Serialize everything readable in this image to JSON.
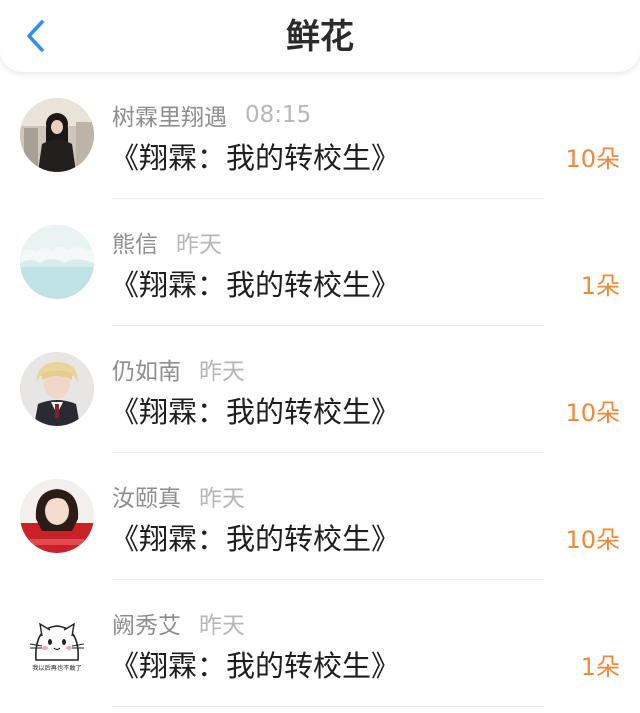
{
  "header": {
    "title": "鲜花",
    "back_icon": "chevron-left-icon",
    "accent": "#2a8ff0"
  },
  "colors": {
    "count": "#f08a3a",
    "name": "#8e8e8e",
    "time": "#b7b7b7",
    "text": "#1e1e1e"
  },
  "rows": [
    {
      "name": "树霖里翔遇",
      "time": "08:15",
      "book": "《翔霖：我的转校生》",
      "count": "10朵",
      "avatar": "avatar-girl-dark-coat"
    },
    {
      "name": "熊信",
      "time": "昨天",
      "book": "《翔霖：我的转校生》",
      "count": "1朵",
      "avatar": "avatar-sky-cloud"
    },
    {
      "name": "仍如南",
      "time": "昨天",
      "book": "《翔霖：我的转校生》",
      "count": "10朵",
      "avatar": "avatar-blond-boy-suit"
    },
    {
      "name": "汝颐真",
      "time": "昨天",
      "book": "《翔霖：我的转校生》",
      "count": "10朵",
      "avatar": "avatar-girl-red-sweater"
    },
    {
      "name": "阙秀艾",
      "time": "昨天",
      "book": "《翔霖：我的转校生》",
      "count": "1朵",
      "avatar": "avatar-cartoon-cat"
    }
  ],
  "avatar_captions": {
    "cat": "我以后再也不敢了"
  }
}
